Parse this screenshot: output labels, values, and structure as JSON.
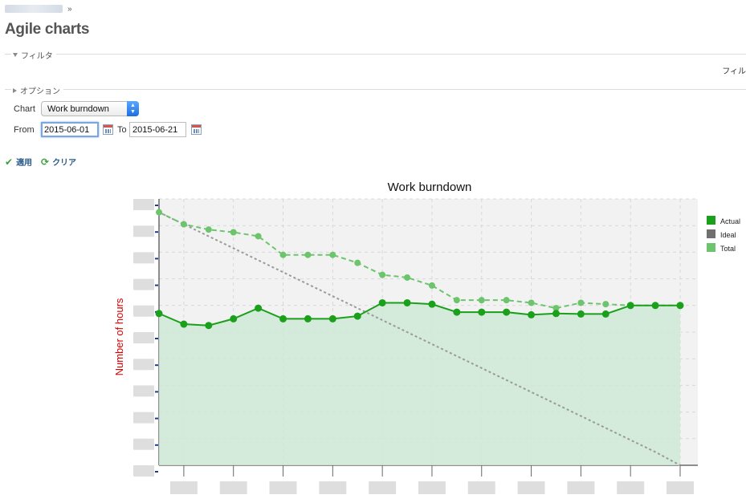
{
  "breadcrumb": {
    "separator": "»"
  },
  "page": {
    "title": "Agile charts"
  },
  "filter": {
    "legend": "フィルタ",
    "right_text": "フィル"
  },
  "options": {
    "legend": "オプション"
  },
  "form": {
    "chart_label": "Chart",
    "chart_value": "Work burndown",
    "from_label": "From",
    "from_value": "2015-06-01",
    "to_label": "To",
    "to_value": "2015-06-21"
  },
  "actions": {
    "apply": "適用",
    "clear": "クリア"
  },
  "icons": {
    "select_arrow": "updown-arrow-icon",
    "calendar": "calendar-icon",
    "apply": "checkmark-icon",
    "clear": "reload-icon"
  },
  "colors": {
    "actual": "#1aa01a",
    "ideal": "#707070",
    "total": "#6cc46c",
    "fill": "#cfe9d6",
    "plot_bg": "#f2f2f2",
    "ylabel": "#d40000"
  },
  "chart_data": {
    "type": "line",
    "title": "Work burndown",
    "xlabel": "",
    "ylabel": "Number of hours",
    "x": [
      1,
      2,
      3,
      4,
      5,
      6,
      7,
      8,
      9,
      10,
      11,
      12,
      13,
      14,
      15,
      16,
      17,
      18,
      19,
      20,
      21,
      22
    ],
    "xlim": [
      1,
      22
    ],
    "ylim": [
      0,
      100
    ],
    "grid": true,
    "legend_position": "right",
    "series": [
      {
        "name": "Actual",
        "style": "solid",
        "filled": true,
        "values": [
          57,
          53,
          52.5,
          55,
          59,
          55,
          55,
          55,
          56,
          61,
          61,
          60.5,
          57.5,
          57.5,
          57.5,
          56.5,
          57,
          56.8,
          56.8,
          60,
          60,
          60
        ]
      },
      {
        "name": "Ideal",
        "style": "dotted",
        "values": [
          95,
          90.5,
          86,
          81.5,
          77,
          72.5,
          68,
          63.5,
          59,
          54.5,
          50,
          45.5,
          41,
          36.5,
          32,
          27.5,
          23,
          18.5,
          14,
          9.5,
          5,
          0
        ]
      },
      {
        "name": "Total",
        "style": "dashed",
        "values": [
          95,
          90.5,
          88.5,
          87.5,
          86,
          79,
          79,
          79,
          76,
          71.5,
          70.5,
          67.5,
          62,
          62,
          62,
          61,
          59,
          61,
          60.5,
          60,
          60,
          60
        ]
      }
    ]
  }
}
